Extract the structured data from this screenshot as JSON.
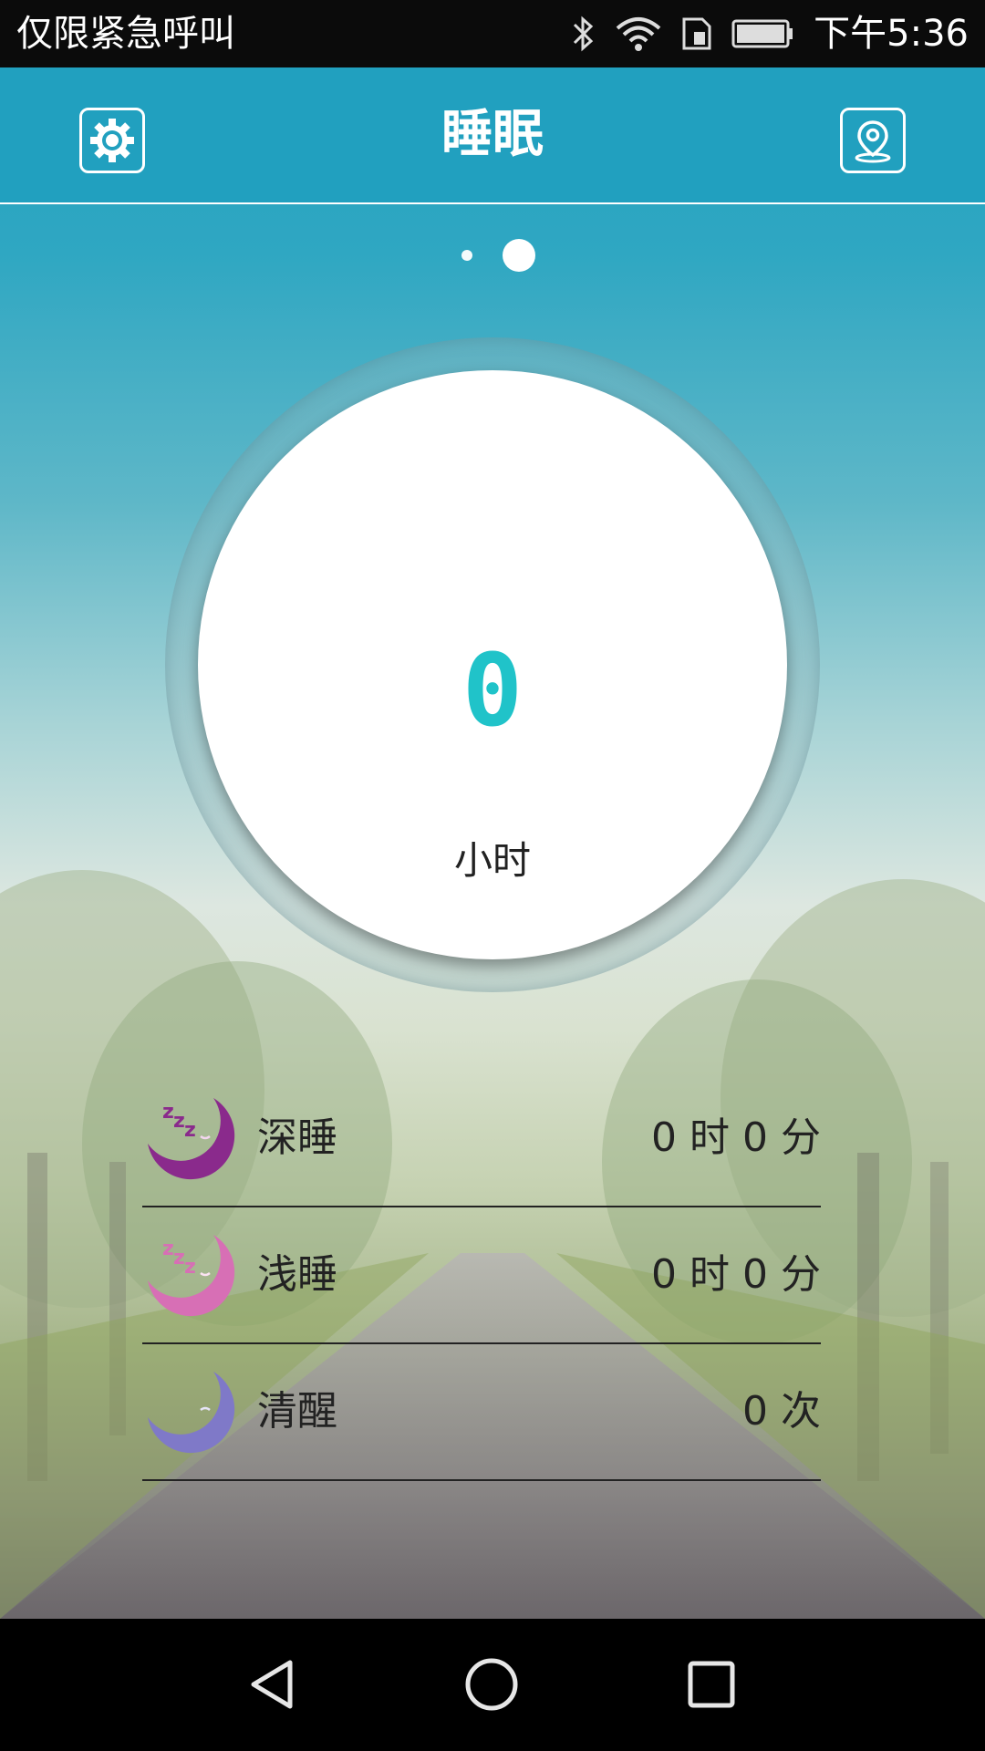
{
  "status_bar": {
    "carrier": "仅限紧急呼叫",
    "time": "下午5:36",
    "icons": [
      "bluetooth-icon",
      "wifi-icon",
      "sim-icon",
      "battery-icon"
    ]
  },
  "header": {
    "title": "睡眠",
    "left_icon": "settings-gear-icon",
    "right_icon": "location-pin-icon"
  },
  "pager": {
    "page_count": 2,
    "active_index": 1
  },
  "summary": {
    "hours_value": "0",
    "hours_unit": "小时"
  },
  "stats": [
    {
      "label": "深睡",
      "value": "0 时 0 分",
      "icon": "moon-deep-sleep-icon",
      "color": "#8a2a8c"
    },
    {
      "label": "浅睡",
      "value": "0 时 0 分",
      "icon": "moon-light-sleep-icon",
      "color": "#d76fb5"
    },
    {
      "label": "清醒",
      "value": "0 次",
      "icon": "moon-awake-icon",
      "color": "#7f79c8"
    }
  ],
  "nav_bar": {
    "icons": [
      "back-icon",
      "home-icon",
      "recents-icon"
    ]
  },
  "colors": {
    "header": "#21a0bf",
    "hours_value": "#20c3c9"
  }
}
